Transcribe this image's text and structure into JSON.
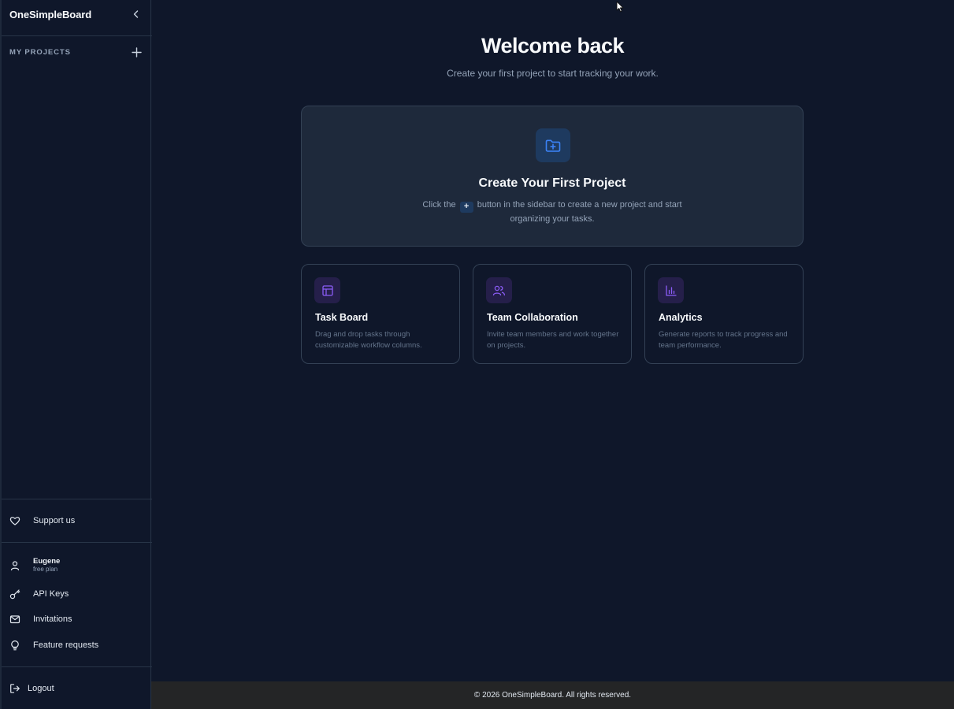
{
  "app": {
    "brand": "OneSimpleBoard"
  },
  "sidebar": {
    "projects_label": "MY PROJECTS",
    "support_label": "Support us",
    "user": {
      "name": "Eugene",
      "plan": "free plan"
    },
    "menu": [
      {
        "label": "API Keys",
        "icon": "key-icon"
      },
      {
        "label": "Invitations",
        "icon": "mail-icon"
      },
      {
        "label": "Feature requests",
        "icon": "lightbulb-icon"
      }
    ],
    "logout_label": "Logout"
  },
  "main": {
    "title": "Welcome back",
    "subtitle": "Create your first project to start tracking your work.",
    "create_card": {
      "title": "Create Your First Project",
      "desc_before": "Click the",
      "plus_glyph": "+",
      "desc_after": "button in the sidebar to create a new project and start organizing your tasks."
    },
    "features": [
      {
        "title": "Task Board",
        "desc": "Drag and drop tasks through customizable workflow columns.",
        "icon": "layout-icon"
      },
      {
        "title": "Team Collaboration",
        "desc": "Invite team members and work together on projects.",
        "icon": "users-icon"
      },
      {
        "title": "Analytics",
        "desc": "Generate reports to track progress and team performance.",
        "icon": "bar-chart-icon"
      }
    ]
  },
  "footer": {
    "text": "© 2026 OneSimpleBoard. All rights reserved."
  },
  "colors": {
    "background": "#0f172a",
    "card": "#1e293b",
    "accent_blue": "#3b82f6",
    "accent_purple": "#8b5cf6",
    "footer_bg": "#242526"
  }
}
